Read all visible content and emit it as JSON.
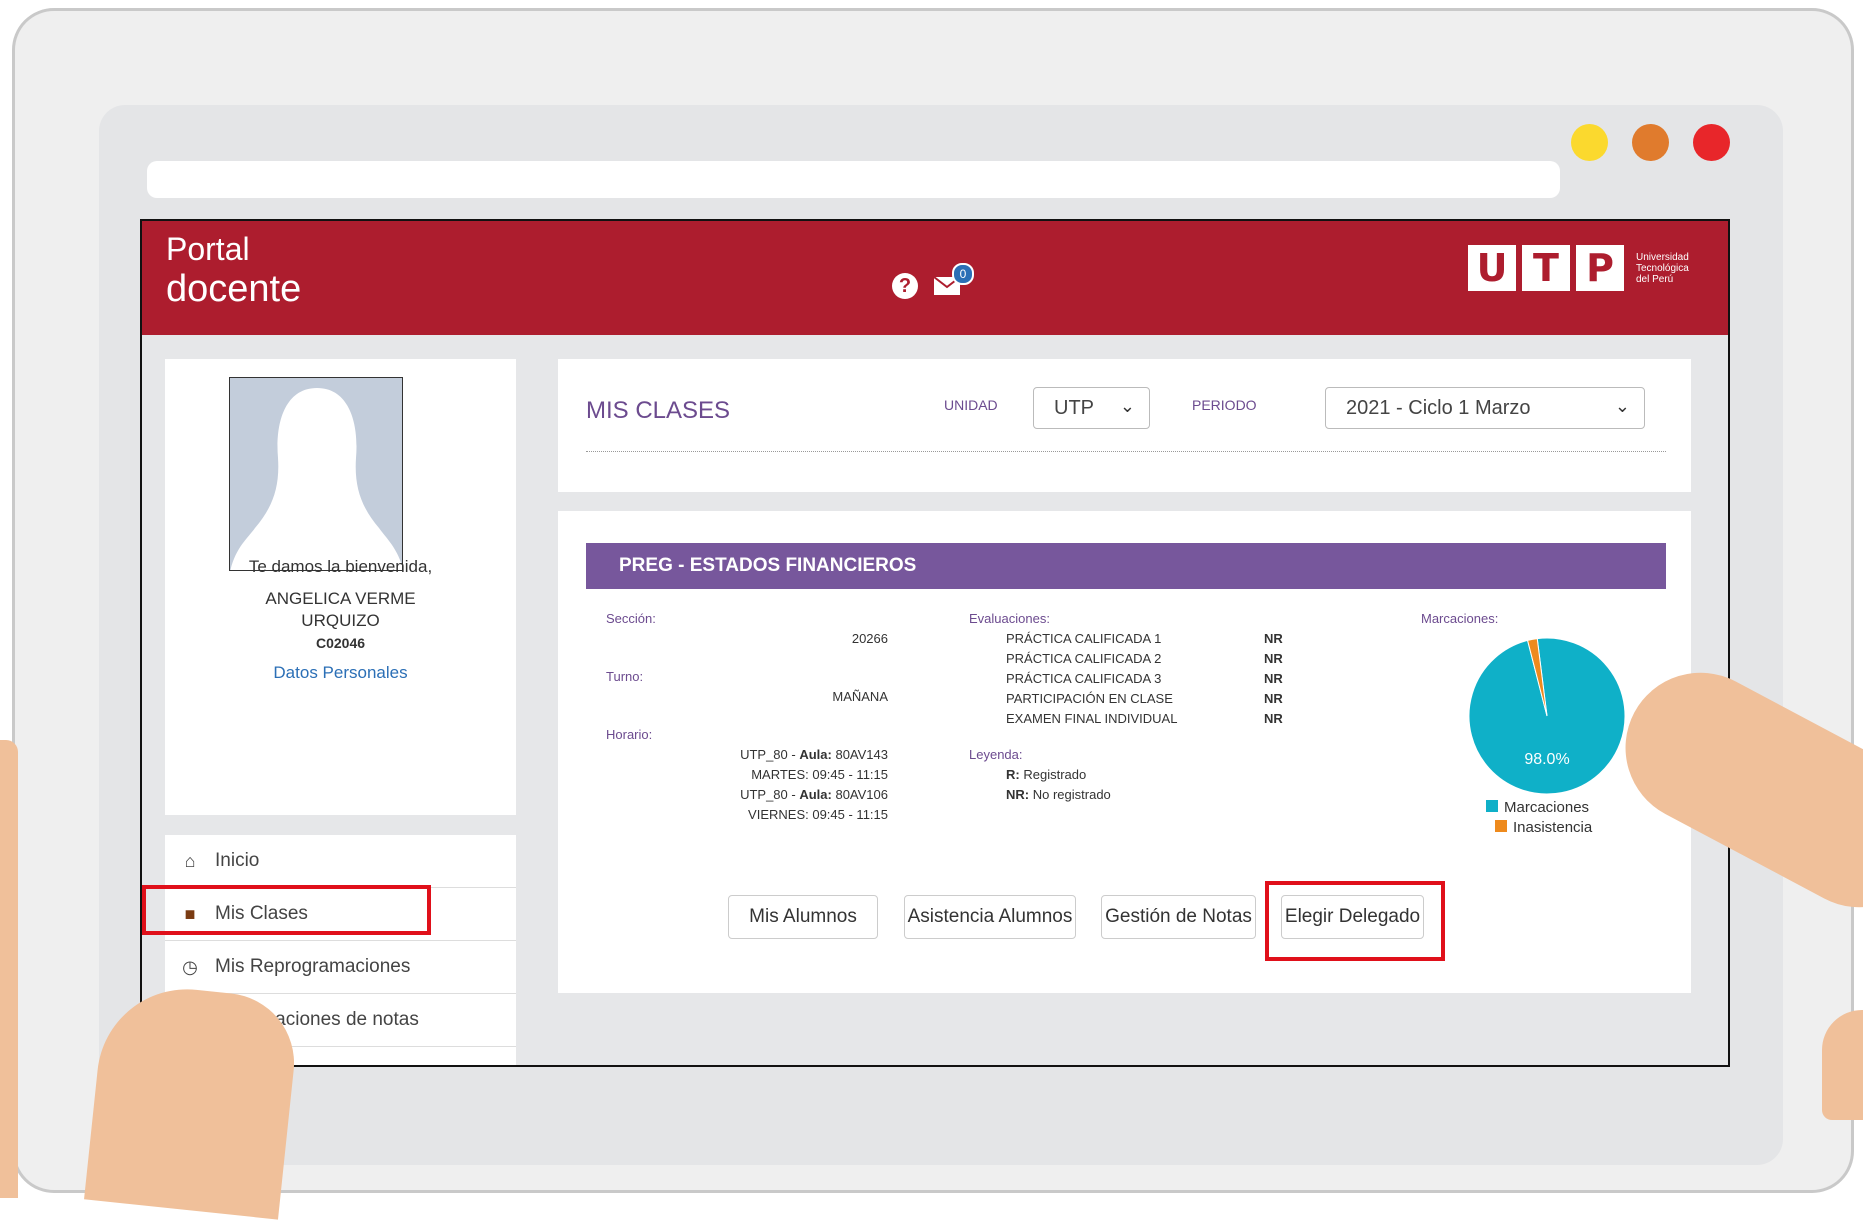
{
  "browser": {
    "dots": [
      "#fbd92e",
      "#e07b2d",
      "#e8262a"
    ]
  },
  "header": {
    "brand_line1": "Portal",
    "brand_line2": "docente",
    "mail_count": "0",
    "logo_letters": [
      "U",
      "T",
      "P"
    ],
    "logo_sub": [
      "Universidad",
      "Tecnológica",
      "del Perú"
    ]
  },
  "profile": {
    "welcome": "Te damos la bienvenida,",
    "name_line1": "ANGELICA VERME",
    "name_line2": "URQUIZO",
    "code": "C02046",
    "personal_link": "Datos Personales"
  },
  "menu": {
    "items": [
      "Inicio",
      "Mis Clases",
      "Mis Reprogramaciones",
      "Modificaciones de notas"
    ]
  },
  "filters": {
    "title": "MIS CLASES",
    "unidad_label": "UNIDAD",
    "unidad_value": "UTP",
    "periodo_label": "PERIODO",
    "periodo_value": "2021 - Ciclo 1 Marzo"
  },
  "course": {
    "name": "PREG - ESTADOS FINANCIEROS",
    "seccion_label": "Sección:",
    "seccion_value": "20266",
    "turno_label": "Turno:",
    "turno_value": "MAÑANA",
    "horario_label": "Horario:",
    "horario": [
      {
        "campus": "UTP_80",
        "aula_label": "Aula:",
        "aula": "80AV143"
      },
      {
        "time": "MARTES: 09:45 - 11:15"
      },
      {
        "campus": "UTP_80",
        "aula_label": "Aula:",
        "aula": "80AV106"
      },
      {
        "time": "VIERNES: 09:45 - 11:15"
      }
    ],
    "evaluaciones_label": "Evaluaciones:",
    "evaluaciones": [
      {
        "name": "PRÁCTICA CALIFICADA 1",
        "status": "NR"
      },
      {
        "name": "PRÁCTICA CALIFICADA 2",
        "status": "NR"
      },
      {
        "name": "PRÁCTICA CALIFICADA 3",
        "status": "NR"
      },
      {
        "name": "PARTICIPACIÓN EN CLASE",
        "status": "NR"
      },
      {
        "name": "EXAMEN FINAL INDIVIDUAL",
        "status": "NR"
      }
    ],
    "leyenda_label": "Leyenda:",
    "leyenda": [
      {
        "code": "R:",
        "text": "Registrado"
      },
      {
        "code": "NR:",
        "text": "No registrado"
      }
    ],
    "marcaciones_label": "Marcaciones:"
  },
  "chart_data": {
    "type": "pie",
    "slices": [
      {
        "name": "Marcaciones",
        "value": 98.0,
        "color": "#0fb0c8"
      },
      {
        "name": "Inasistencia",
        "value": 2.0,
        "color": "#ee8a1d"
      }
    ],
    "data_label": "98.0%",
    "legend_placement": "bottom"
  },
  "actions": {
    "buttons": [
      "Mis Alumnos",
      "Asistencia Alumnos",
      "Gestión de Notas",
      "Elegir Delegado"
    ]
  }
}
